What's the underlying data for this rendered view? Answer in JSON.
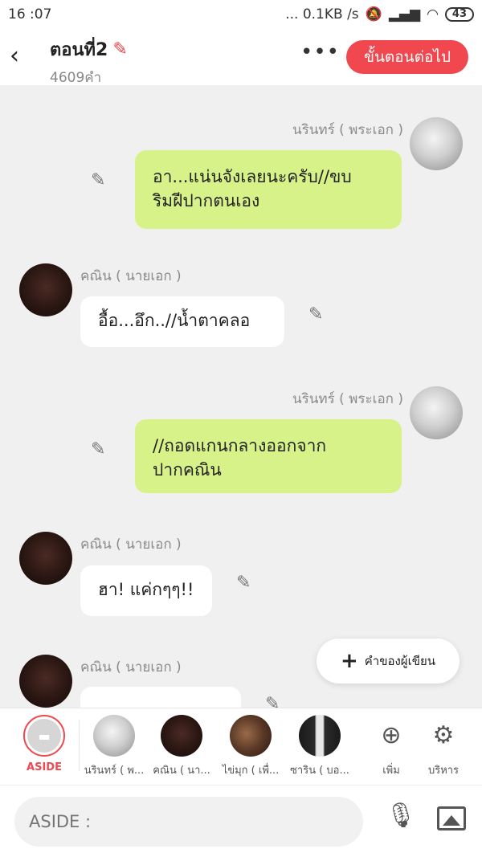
{
  "status_bar": {
    "time": "16 :07",
    "network": "... 0.1KB /s",
    "battery": "43"
  },
  "header": {
    "back_icon": "chevron-left-icon",
    "title": "ตอนที่2",
    "word_count": "4609คำ",
    "more_label": "•••",
    "next_button": "ขั้นตอนต่อไป"
  },
  "messages": [
    {
      "side": "right",
      "name": "นรินทร์ ( พระเอก )",
      "text_line1": "อา...แน่นจังเลยนะครับ//ขบ",
      "text_line2": "ริมฝีปากตนเอง"
    },
    {
      "side": "left",
      "name": "คณิน ( นายเอก )",
      "text_line1": "อื้อ...อึก..//น้ำตาคลอ"
    },
    {
      "side": "right",
      "name": "นรินทร์ ( พระเอก )",
      "text_line1": "//ถอดแกนกลางออกจาก",
      "text_line2": "ปากคณิน"
    },
    {
      "side": "left",
      "name": "คณิน ( นายเอก )",
      "text_line1": "ฮา! แค่กๆๆ!!"
    },
    {
      "side": "left",
      "name": "คณิน ( นายเอก )",
      "text_line1": ""
    }
  ],
  "fab": {
    "label": "คำของผู้เขียน"
  },
  "characters": [
    {
      "label": "ASIDE"
    },
    {
      "label": "นรินทร์ ( พ..."
    },
    {
      "label": "คณิน ( นา..."
    },
    {
      "label": "ไข่มุก ( เพื่..."
    },
    {
      "label": "ซาริน ( บอ..."
    }
  ],
  "tools": {
    "add_label": "เพิ่ม",
    "manage_label": "บริหาร"
  },
  "input": {
    "placeholder": "ASIDE :"
  }
}
